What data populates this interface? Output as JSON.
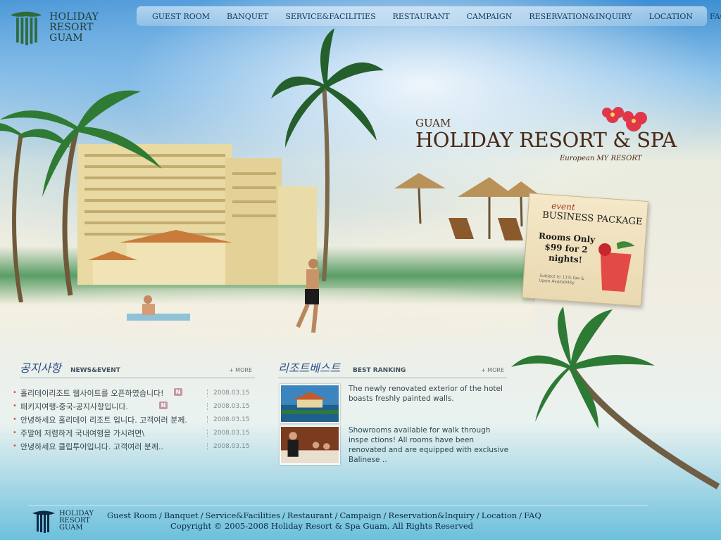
{
  "logo": {
    "line1": "HOLIDAY",
    "line2": "RESORT",
    "line3": "GUAM"
  },
  "nav": {
    "items": [
      {
        "label": "GUEST ROOM"
      },
      {
        "label": "BANQUET"
      },
      {
        "label": "SERVICE&FACILITIES"
      },
      {
        "label": "RESTAURANT"
      },
      {
        "label": "CAMPAIGN"
      },
      {
        "label": "RESERVATION&INQUIRY"
      },
      {
        "label": "LOCATION"
      },
      {
        "label": "FAQ"
      }
    ]
  },
  "hero": {
    "guam": "GUAM",
    "title": "HOLIDAY RESORT & SPA",
    "subtitle": "European MY RESORT"
  },
  "event": {
    "tag": "event",
    "title": "BUSINESS PACKAGE",
    "text": "Rooms Only $99 for 2 nights!",
    "fine": "Subject to 11% tax & Upon Availability"
  },
  "news": {
    "heading_kor": "공지사항",
    "heading_eng": "NEWS&EVENT",
    "more": "+ MORE",
    "items": [
      {
        "title": "홀리데이리조트 웹사이트를 오픈하였습니다!",
        "date": "2008.03.15",
        "badge": "N"
      },
      {
        "title": "패키지여행-중국-공지사항입니다.",
        "date": "2008.03.15",
        "badge": "N"
      },
      {
        "title": "안녕하세요 홀리데이 리조트 입니다. 고객여러 분께..",
        "date": "2008.03.15",
        "badge": ""
      },
      {
        "title": "주말에 저렴하게 국내여행을 가시려면\\",
        "date": "2008.03.15",
        "badge": ""
      },
      {
        "title": "안녕하세요 클립투어입니다. 고객여러 분께..",
        "date": "2008.03.15",
        "badge": ""
      }
    ]
  },
  "ranking": {
    "heading_kor": "리조트베스트",
    "heading_eng": "BEST RANKING",
    "more": "+ MORE",
    "items": [
      {
        "text": "The newly renovated exterior of the hotel boasts freshly painted walls."
      },
      {
        "text": "Showrooms available for walk through inspe ctions! All rooms have been renovated and are equipped with exclusive Balinese .."
      }
    ]
  },
  "footer": {
    "links": [
      "Guest Room",
      "Banquet",
      "Service&Facilities",
      "Restaurant",
      "Campaign",
      "Reservation&Inquiry",
      "Location",
      "FAQ"
    ],
    "separator": "/",
    "copyright": "Copyright © 2005-2008 Holiday Resort & Spa Guam, All Rights Reserved"
  },
  "colors": {
    "nav_text": "#123a5c",
    "title_brown": "#4a2a14",
    "news_bullet": "#d2543a",
    "badge": "#c29aa4",
    "footer_text": "#0d2a44"
  }
}
